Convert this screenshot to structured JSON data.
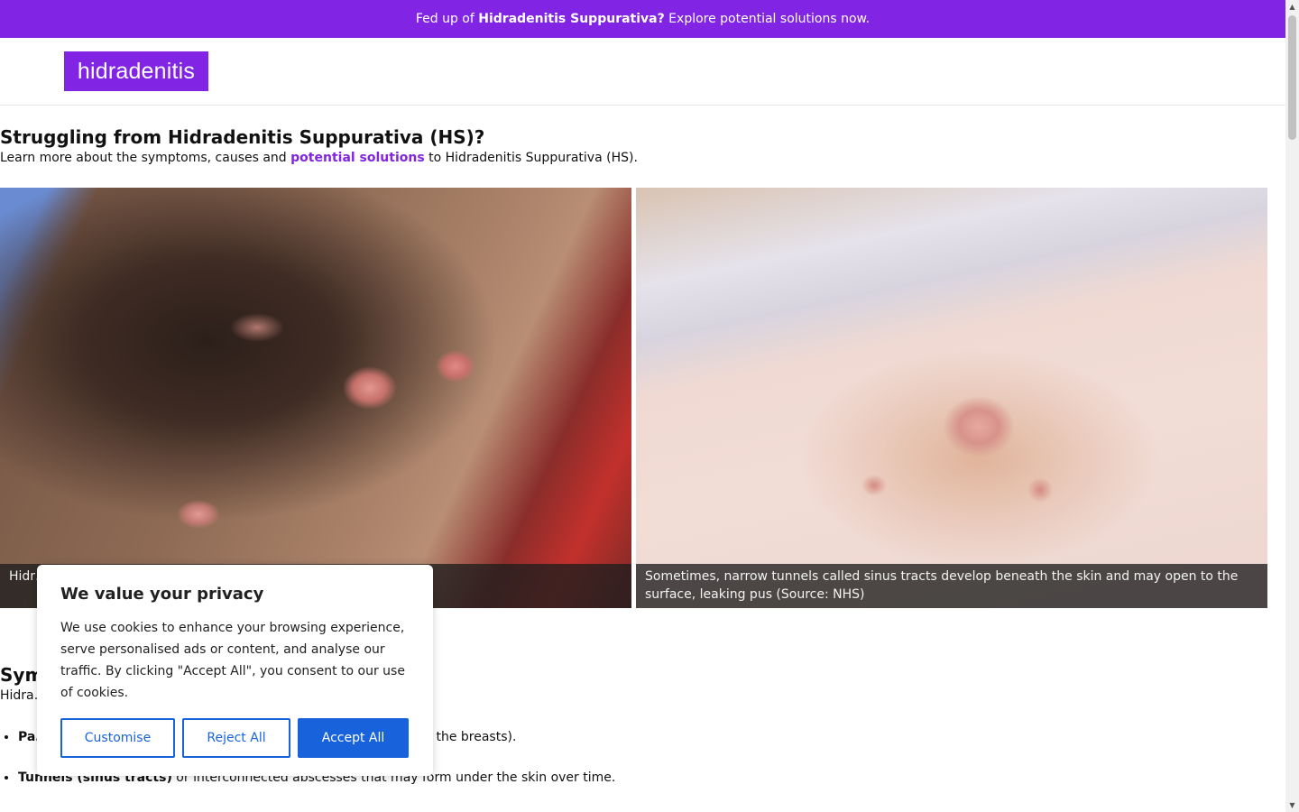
{
  "banner": {
    "prefix": "Fed up of ",
    "bold": "Hidradenitis Suppurativa?",
    "suffix": " Explore potential solutions now."
  },
  "header": {
    "logo_text": "hidradenitis"
  },
  "intro": {
    "heading": "Struggling from Hidradenitis Suppurativa (HS)?",
    "text_before": "Learn more about the symptoms, causes and ",
    "link_text": "potential solutions",
    "text_after": " to Hidradenitis Suppurativa (HS)."
  },
  "figures": [
    {
      "caption": "Hidr… form on the skin’s surface (Sou…"
    },
    {
      "caption": "Sometimes, narrow tunnels called sinus tracts develop beneath the skin and may open to the surface, leaking pus (Source: NHS)"
    }
  ],
  "symptoms": {
    "heading": "Sym… S)",
    "intro": "Hidra… ed by:",
    "items": [
      {
        "bold": "Pa…",
        "text": " skin rubs together (e.g., armpits, groin, buttocks, and under the breasts)."
      },
      {
        "bold": "Tunnels (sinus tracts)",
        "text": " or interconnected abscesses that may form under the skin over time."
      }
    ]
  },
  "cookie": {
    "title": "We value your privacy",
    "body": "We use cookies to enhance your browsing experience, serve personalised ads or content, and analyse our traffic. By clicking \"Accept All\", you consent to our use of cookies.",
    "customise": "Customise",
    "reject": "Reject All",
    "accept": "Accept All"
  },
  "colors": {
    "brand": "#8224e3",
    "cookie_button": "#1863dc"
  }
}
